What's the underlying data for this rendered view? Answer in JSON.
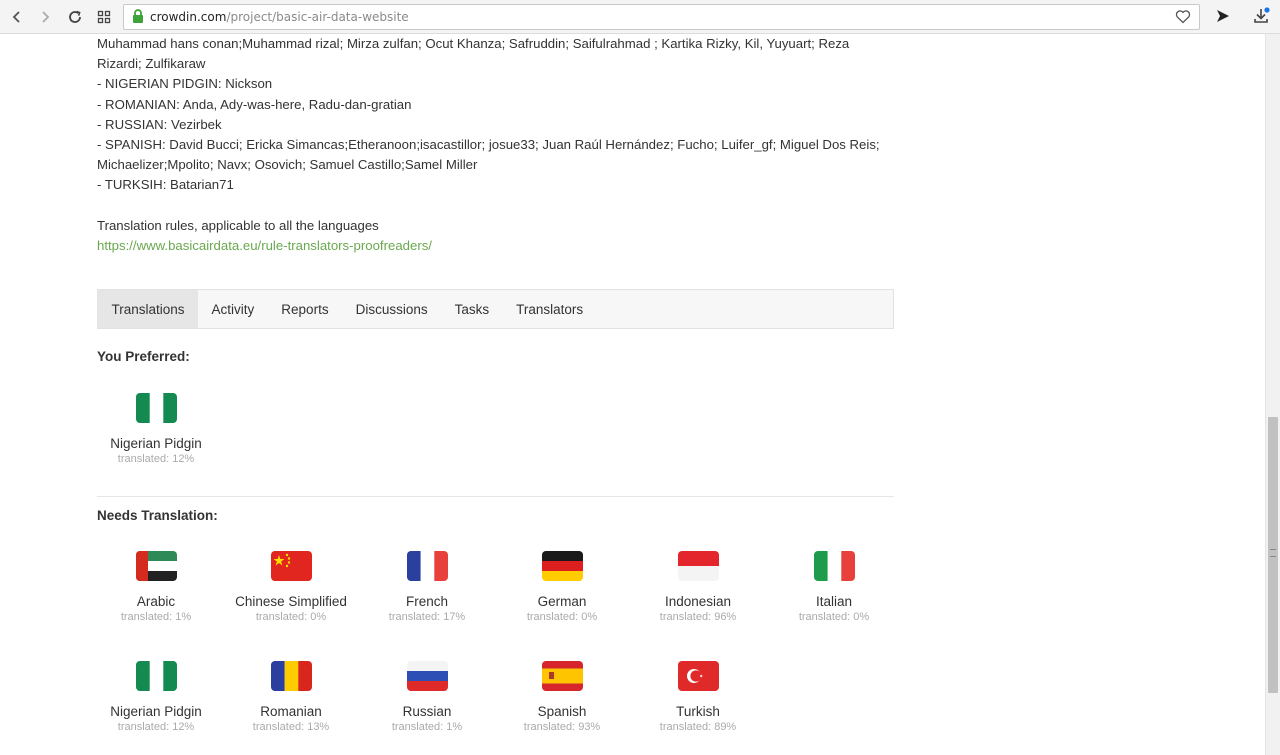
{
  "browser": {
    "url_host": "crowdin.com",
    "url_path": "/project/basic-air-data-website"
  },
  "credits": {
    "lines": [
      "Muhammad hans conan;Muhammad rizal; Mirza zulfan; Ocut Khanza; Safruddin; Saifulrahmad ; Kartika Rizky, Kil, Yuyuart; Reza",
      "Rizardi; Zulfikaraw",
      "- NIGERIAN PIDGIN: Nickson",
      "- ROMANIAN: Anda, Ady-was-here, Radu-dan-gratian",
      "- RUSSIAN: Vezirbek",
      "- SPANISH: David Bucci; Ericka Simancas;Etheranoon;isacastillor; josue33; Juan Raúl Hernández; Fucho; Luifer_gf; Miguel Dos Reis;",
      "Michaelizer;Mpolito; Navx; Osovich; Samuel Castillo;Samel Miller",
      "- TURKSIH: Batarian71"
    ],
    "rules_text": "Translation rules, applicable to all the languages",
    "rules_link": "https://www.basicairdata.eu/rule-translators-proofreaders/"
  },
  "tabs": [
    "Translations",
    "Activity",
    "Reports",
    "Discussions",
    "Tasks",
    "Translators"
  ],
  "preferred": {
    "title": "You Preferred:",
    "languages": [
      {
        "name": "Nigerian Pidgin",
        "progress": "translated: 12%"
      }
    ]
  },
  "needs": {
    "title": "Needs Translation:",
    "languages": [
      {
        "name": "Arabic",
        "progress": "translated: 1%"
      },
      {
        "name": "Chinese Simplified",
        "progress": "translated: 0%"
      },
      {
        "name": "French",
        "progress": "translated: 17%"
      },
      {
        "name": "German",
        "progress": "translated: 0%"
      },
      {
        "name": "Indonesian",
        "progress": "translated: 96%"
      },
      {
        "name": "Italian",
        "progress": "translated: 0%"
      },
      {
        "name": "Nigerian Pidgin",
        "progress": "translated: 12%"
      },
      {
        "name": "Romanian",
        "progress": "translated: 13%"
      },
      {
        "name": "Russian",
        "progress": "translated: 1%"
      },
      {
        "name": "Spanish",
        "progress": "translated: 93%"
      },
      {
        "name": "Turkish",
        "progress": "translated: 89%"
      }
    ]
  },
  "colors": {
    "link_green": "#6aa84f",
    "secure_lock": "#3da33a",
    "active_tab": "#e6e6e6"
  }
}
